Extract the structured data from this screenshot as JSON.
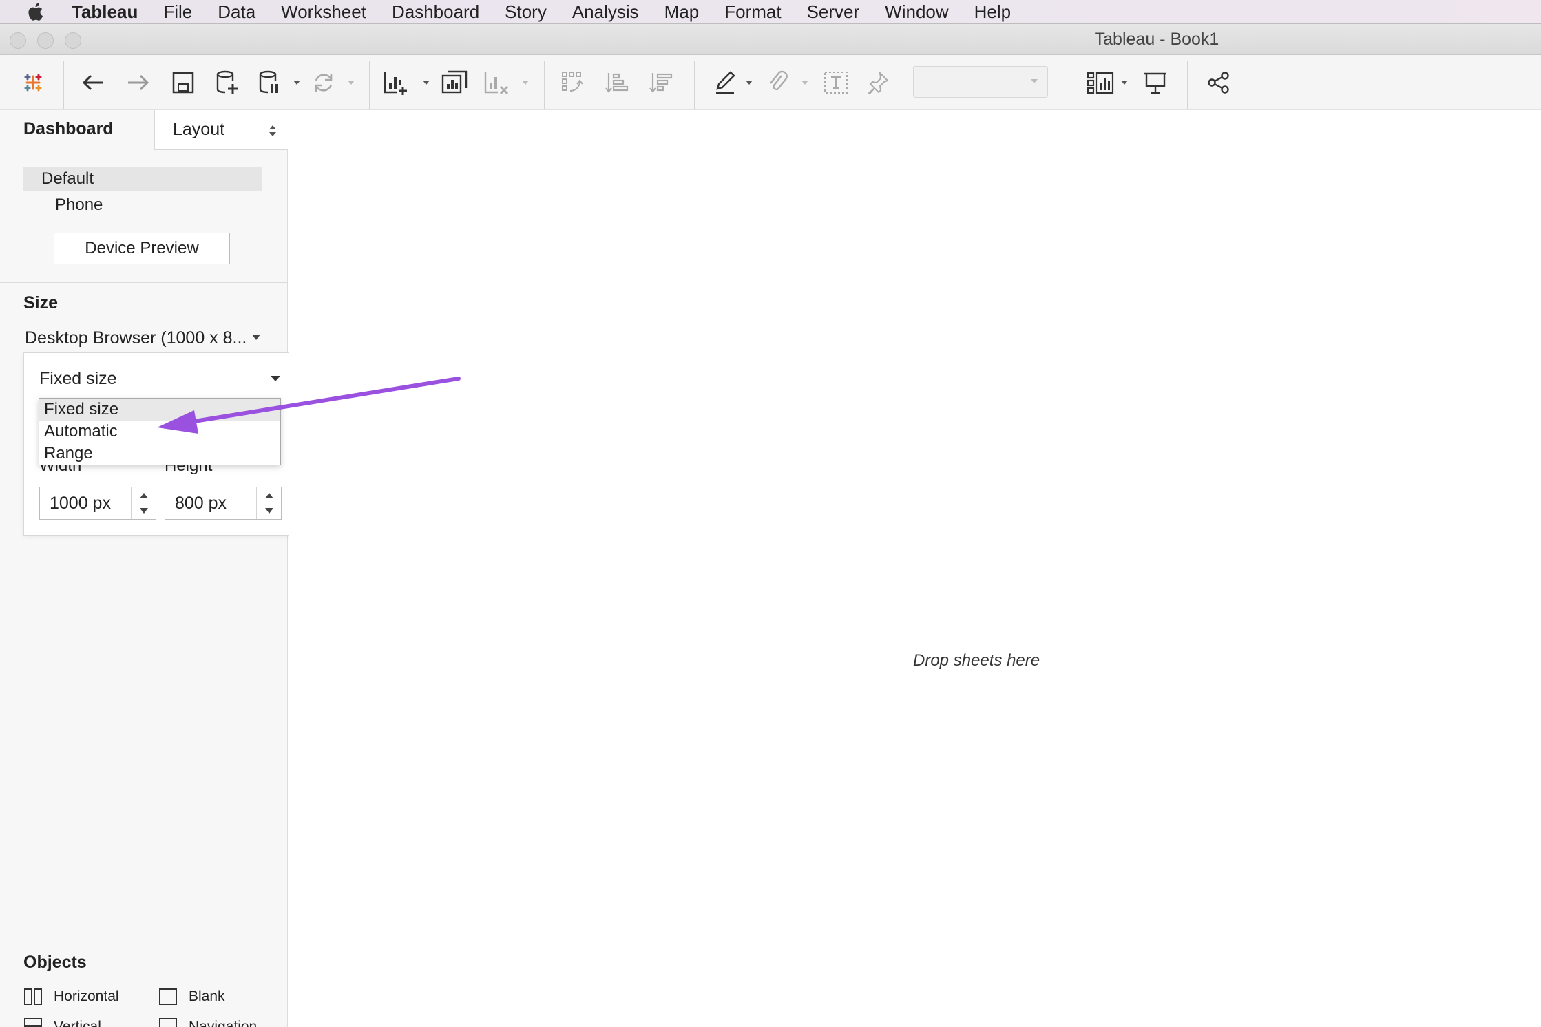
{
  "menubar": {
    "app": "Tableau",
    "items": [
      "File",
      "Data",
      "Worksheet",
      "Dashboard",
      "Story",
      "Analysis",
      "Map",
      "Format",
      "Server",
      "Window",
      "Help"
    ]
  },
  "window": {
    "title": "Tableau - Book1"
  },
  "toolbar": {
    "icons": [
      "tableau-logo-icon",
      "undo-icon",
      "redo-icon",
      "save-icon",
      "new-data-source-icon",
      "pause-auto-updates-icon",
      "refresh-icon",
      "new-worksheet-icon",
      "new-dashboard-icon",
      "clear-sheet-icon",
      "swap-icon",
      "sort-ascending-icon",
      "sort-descending-icon",
      "highlight-icon",
      "group-icon",
      "labels-icon",
      "fix-axes-icon",
      "fit-selector",
      "show-cards-icon",
      "presentation-mode-icon",
      "share-icon"
    ]
  },
  "panel": {
    "tabs": {
      "dashboard": "Dashboard",
      "layout": "Layout"
    },
    "device": {
      "default": "Default",
      "phone": "Phone",
      "preview_button": "Device Preview"
    },
    "size": {
      "heading": "Size",
      "preset": "Desktop Browser (1000 x 8...",
      "mode": "Fixed size",
      "options": [
        "Fixed size",
        "Automatic",
        "Range"
      ],
      "width_label": "Width",
      "height_label": "Height",
      "width_value": "1000 px",
      "height_value": "800 px"
    },
    "objects": {
      "heading": "Objects",
      "items": [
        "Horizontal",
        "Blank",
        "Vertical",
        "Navigation"
      ]
    }
  },
  "canvas": {
    "hint": "Drop sheets here"
  },
  "colors": {
    "annotation_arrow": "#9b51e0",
    "menubar": "#ece6ef",
    "toolbar": "#f5f5f5"
  }
}
